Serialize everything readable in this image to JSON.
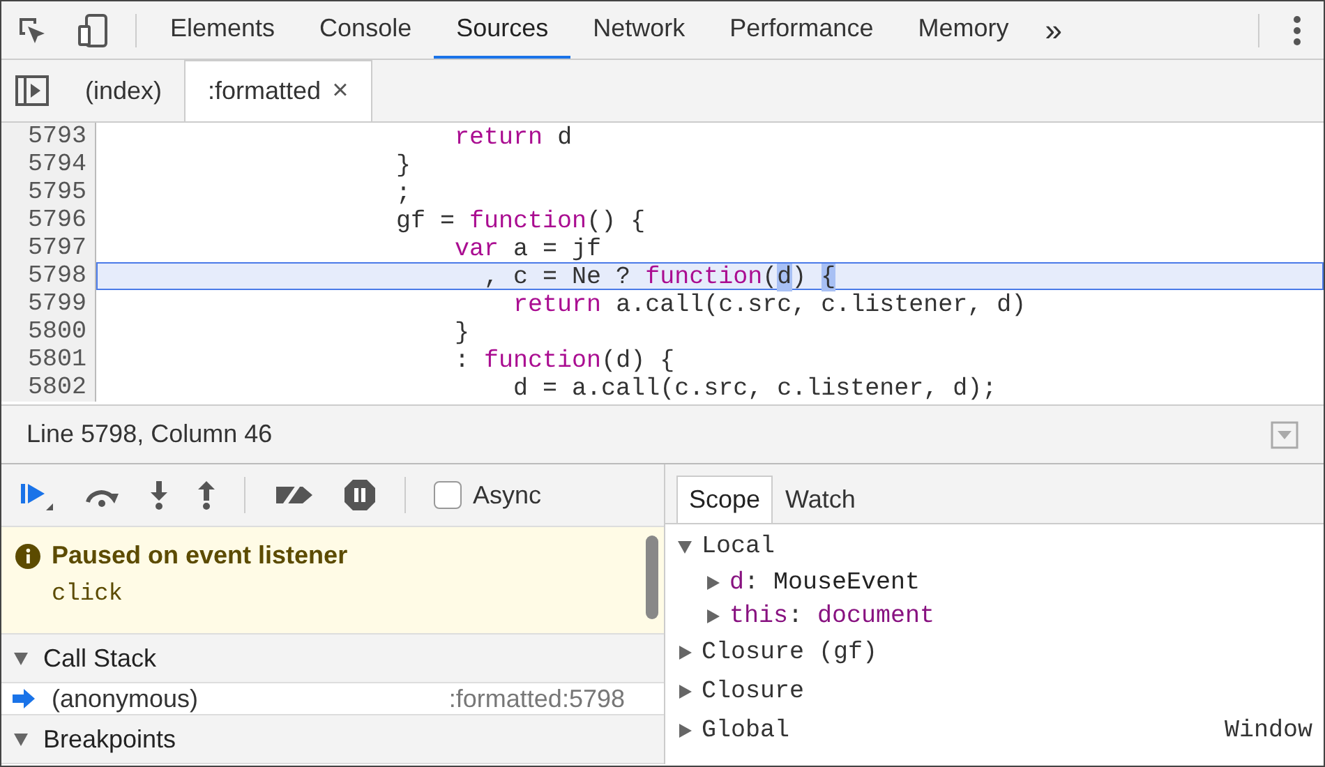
{
  "toolbar": {
    "tabs": [
      {
        "label": "Elements",
        "selected": false
      },
      {
        "label": "Console",
        "selected": false
      },
      {
        "label": "Sources",
        "selected": true
      },
      {
        "label": "Network",
        "selected": false
      },
      {
        "label": "Performance",
        "selected": false
      },
      {
        "label": "Memory",
        "selected": false
      }
    ],
    "more": "»"
  },
  "file_tabs": [
    {
      "label": "(index)",
      "selected": false
    },
    {
      "label": ":formatted",
      "selected": true,
      "close": "×"
    }
  ],
  "editor": {
    "lines": [
      {
        "number": "5793",
        "selected": false,
        "tokens": [
          {
            "text": "                        return",
            "kind": "keyword"
          },
          {
            "text": " d",
            "kind": "plain"
          }
        ]
      },
      {
        "number": "5794",
        "selected": false,
        "tokens": [
          {
            "text": "                    }",
            "kind": "plain"
          }
        ]
      },
      {
        "number": "5795",
        "selected": false,
        "tokens": [
          {
            "text": "                    ;",
            "kind": "plain"
          }
        ]
      },
      {
        "number": "5796",
        "selected": false,
        "tokens": [
          {
            "text": "                    gf = ",
            "kind": "plain"
          },
          {
            "text": "function",
            "kind": "keyword"
          },
          {
            "text": "() {",
            "kind": "plain"
          }
        ]
      },
      {
        "number": "5797",
        "selected": false,
        "tokens": [
          {
            "text": "                        var",
            "kind": "keyword"
          },
          {
            "text": " a = jf",
            "kind": "plain"
          }
        ]
      },
      {
        "number": "5798",
        "selected": true,
        "tokens": [
          {
            "text": "                          , c = Ne ? ",
            "kind": "plain"
          },
          {
            "text": "function",
            "kind": "keyword"
          },
          {
            "text": "(",
            "kind": "plain"
          },
          {
            "text": "d",
            "kind": "marked"
          },
          {
            "text": ") ",
            "kind": "plain"
          },
          {
            "text": "{",
            "kind": "marked"
          }
        ]
      },
      {
        "number": "5799",
        "selected": false,
        "tokens": [
          {
            "text": "                            return",
            "kind": "keyword"
          },
          {
            "text": " a.call(c.src, c.listener, d)",
            "kind": "plain"
          }
        ]
      },
      {
        "number": "5800",
        "selected": false,
        "tokens": [
          {
            "text": "                        }",
            "kind": "plain"
          }
        ]
      },
      {
        "number": "5801",
        "selected": false,
        "tokens": [
          {
            "text": "                        : ",
            "kind": "plain"
          },
          {
            "text": "function",
            "kind": "keyword"
          },
          {
            "text": "(d) {",
            "kind": "plain"
          }
        ]
      },
      {
        "number": "5802",
        "selected": false,
        "tokens": [
          {
            "text": "                            d = a.call(c.src, c.listener, d);",
            "kind": "plain"
          }
        ]
      }
    ]
  },
  "status_bar": {
    "text": "Line 5798, Column 46"
  },
  "debugger": {
    "async": {
      "label": "Async",
      "checked": false
    },
    "pause_message": {
      "title": "Paused on event listener",
      "detail": "click"
    },
    "sections": [
      {
        "title": "Call Stack",
        "expanded": true,
        "frames": [
          {
            "name": "(anonymous)",
            "location": ":formatted:5798",
            "current": true
          }
        ]
      },
      {
        "title": "Breakpoints",
        "expanded": true
      }
    ]
  },
  "scope_panel": {
    "tabs": [
      {
        "label": "Scope",
        "selected": true
      },
      {
        "label": "Watch",
        "selected": false
      }
    ],
    "tree": [
      {
        "label": "Local",
        "expanded": true,
        "children": [
          {
            "name": "d",
            "separator": ":",
            "value": "MouseEvent",
            "color": "#222222"
          },
          {
            "name": "this",
            "separator": ":",
            "value": "document",
            "color": "#881280"
          }
        ]
      },
      {
        "label": "Closure (gf)",
        "expanded": false
      },
      {
        "label": "Closure",
        "expanded": false
      },
      {
        "label": "Global",
        "value": "Window",
        "expanded": false
      }
    ]
  }
}
